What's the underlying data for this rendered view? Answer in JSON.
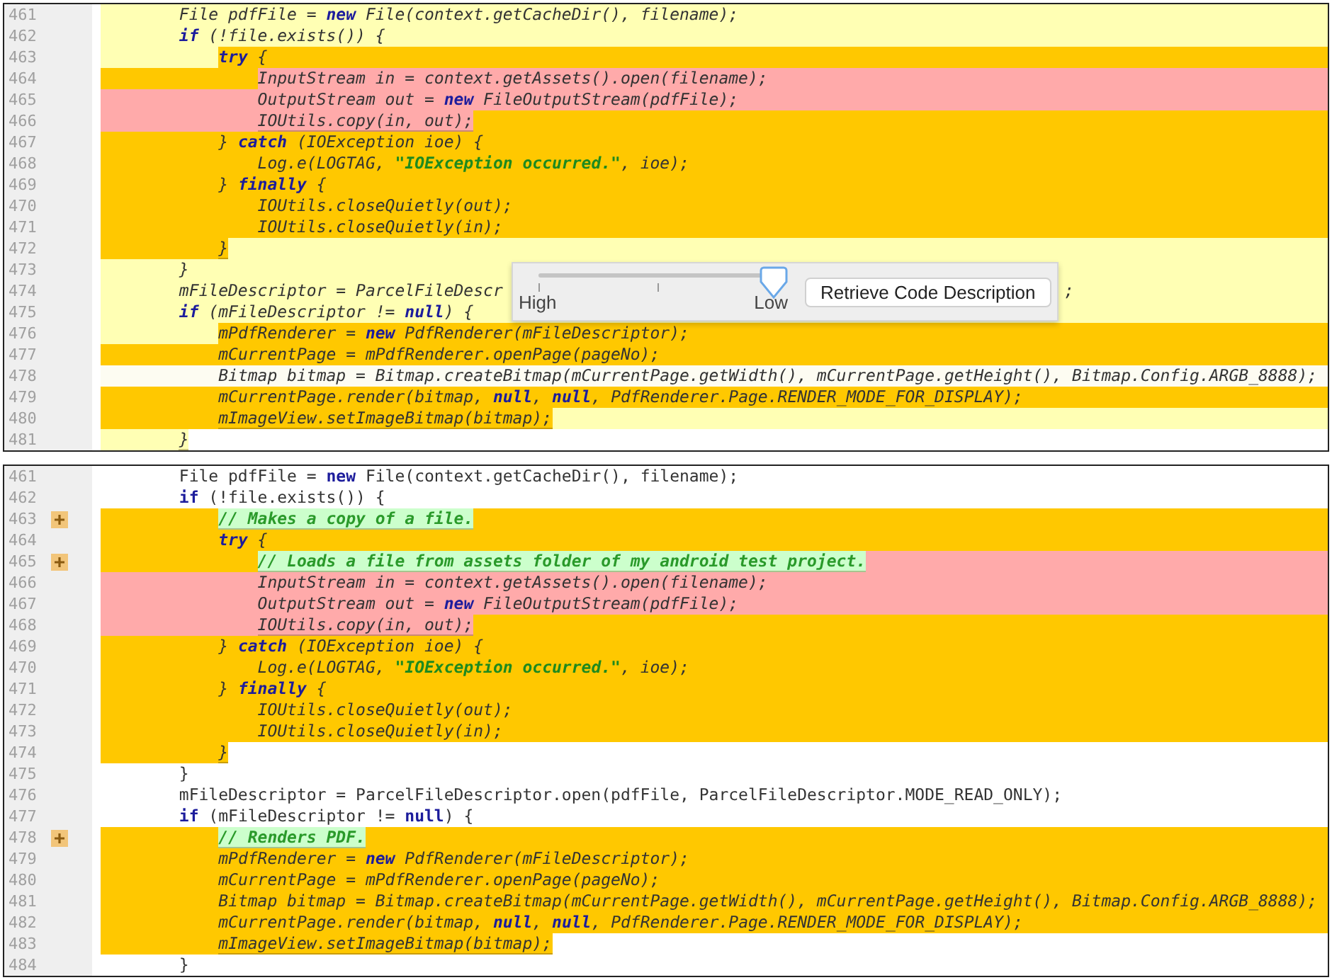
{
  "panels": [
    {
      "lines": [
        {
          "n": "461",
          "italic": true,
          "color": "#ffffb4",
          "bands": [
            {
              "kind": "rest",
              "color": "#ffffb4"
            }
          ],
          "code": [
            {
              "kind": "plain",
              "text": "        File pdfFile = "
            },
            {
              "kind": "keyword",
              "text": "new"
            },
            {
              "kind": "plain",
              "text": " File(context.getCacheDir(), filename);"
            }
          ]
        },
        {
          "n": "462",
          "italic": true,
          "color": "#ffffb4",
          "bands": [
            {
              "kind": "lead",
              "color": "#ffffb4"
            },
            {
              "kind": "rest",
              "color": "#ffffb4"
            }
          ],
          "code": [
            {
              "kind": "keyword",
              "text": "        if"
            },
            {
              "kind": "plain",
              "text": " (!file.exists()) {"
            }
          ]
        },
        {
          "n": "463",
          "italic": true,
          "color": "#ffc800",
          "bands": [
            {
              "kind": "lead",
              "color": "#ffffb4"
            },
            {
              "kind": "rest",
              "color": "#ffc800"
            }
          ],
          "code": [
            {
              "kind": "keyword",
              "text": "            try"
            },
            {
              "kind": "plain",
              "text": " {"
            }
          ]
        },
        {
          "n": "464",
          "italic": true,
          "color": "#ffaaaa",
          "bands": [
            {
              "kind": "lead",
              "color": "#ffc800"
            },
            {
              "kind": "rest",
              "color": "#ffaaaa"
            }
          ],
          "code": [
            {
              "kind": "plain",
              "text": "                InputStream in = context.getAssets().open(filename);"
            }
          ]
        },
        {
          "n": "465",
          "italic": true,
          "color": "#ffaaaa",
          "bands": [
            {
              "kind": "lead",
              "color": "#ffaaaa"
            },
            {
              "kind": "rest",
              "color": "#ffaaaa"
            }
          ],
          "code": [
            {
              "kind": "plain",
              "text": "                OutputStream out = "
            },
            {
              "kind": "keyword",
              "text": "new"
            },
            {
              "kind": "plain",
              "text": " FileOutputStream(pdfFile);"
            }
          ]
        },
        {
          "n": "466",
          "italic": true,
          "color": "#ffaaaa",
          "bands": [
            {
              "kind": "lead",
              "color": "#ffaaaa"
            },
            {
              "kind": "rest",
              "color": "#ffc800"
            }
          ],
          "code": [
            {
              "kind": "plain",
              "text": "                IOUtils.copy(in, out);"
            }
          ]
        },
        {
          "n": "467",
          "italic": true,
          "color": "#ffc800",
          "bands": [
            {
              "kind": "lead",
              "color": "#ffc800"
            },
            {
              "kind": "rest",
              "color": "#ffc800"
            }
          ],
          "code": [
            {
              "kind": "plain",
              "text": "            } "
            },
            {
              "kind": "keyword",
              "text": "catch"
            },
            {
              "kind": "plain",
              "text": " (IOException ioe) {"
            }
          ]
        },
        {
          "n": "468",
          "italic": true,
          "color": "#ffc800",
          "bands": [
            {
              "kind": "lead",
              "color": "#ffc800"
            },
            {
              "kind": "rest",
              "color": "#ffc800"
            }
          ],
          "code": [
            {
              "kind": "plain",
              "text": "                Log.e(LOGTAG, "
            },
            {
              "kind": "string",
              "text": "\"IOException occurred.\""
            },
            {
              "kind": "plain",
              "text": ", ioe);"
            }
          ]
        },
        {
          "n": "469",
          "italic": true,
          "color": "#ffc800",
          "bands": [
            {
              "kind": "lead",
              "color": "#ffc800"
            },
            {
              "kind": "rest",
              "color": "#ffc800"
            }
          ],
          "code": [
            {
              "kind": "plain",
              "text": "            } "
            },
            {
              "kind": "keyword",
              "text": "finally"
            },
            {
              "kind": "plain",
              "text": " {"
            }
          ]
        },
        {
          "n": "470",
          "italic": true,
          "color": "#ffc800",
          "bands": [
            {
              "kind": "lead",
              "color": "#ffc800"
            },
            {
              "kind": "rest",
              "color": "#ffc800"
            }
          ],
          "code": [
            {
              "kind": "plain",
              "text": "                IOUtils.closeQuietly(out);"
            }
          ]
        },
        {
          "n": "471",
          "italic": true,
          "color": "#ffc800",
          "bands": [
            {
              "kind": "lead",
              "color": "#ffc800"
            },
            {
              "kind": "rest",
              "color": "#ffc800"
            }
          ],
          "code": [
            {
              "kind": "plain",
              "text": "                IOUtils.closeQuietly(in);"
            }
          ]
        },
        {
          "n": "472",
          "italic": true,
          "color": "#ffc800",
          "bands": [
            {
              "kind": "lead",
              "color": "#ffc800"
            },
            {
              "kind": "rest",
              "color": "#ffffb4"
            }
          ],
          "code": [
            {
              "kind": "plain",
              "text": "            }"
            }
          ]
        },
        {
          "n": "473",
          "italic": true,
          "color": "#ffffb4",
          "bands": [
            {
              "kind": "lead",
              "color": "#ffffb4"
            },
            {
              "kind": "rest",
              "color": "#ffffb4"
            }
          ],
          "code": [
            {
              "kind": "plain",
              "text": "        }"
            }
          ]
        },
        {
          "n": "474",
          "italic": true,
          "color": "#ffffb4",
          "bands": [
            {
              "kind": "lead",
              "color": "#ffffb4"
            },
            {
              "kind": "rest",
              "color": "#ffffb4"
            }
          ],
          "code": [
            {
              "kind": "plain",
              "text": "        mFileDescriptor = ParcelFileDescr"
            }
          ],
          "tail": ";"
        },
        {
          "n": "475",
          "italic": true,
          "color": "#ffffb4",
          "bands": [
            {
              "kind": "lead",
              "color": "#ffffb4"
            },
            {
              "kind": "rest",
              "color": "#ffffb4"
            }
          ],
          "code": [
            {
              "kind": "keyword",
              "text": "        if"
            },
            {
              "kind": "plain",
              "text": " (mFileDescriptor != "
            },
            {
              "kind": "keyword",
              "text": "null"
            },
            {
              "kind": "plain",
              "text": ") {"
            }
          ]
        },
        {
          "n": "476",
          "italic": true,
          "color": "#ffc800",
          "bands": [
            {
              "kind": "lead",
              "color": "#ffffb4"
            },
            {
              "kind": "rest",
              "color": "#ffc800"
            }
          ],
          "code": [
            {
              "kind": "plain",
              "text": "            mPdfRenderer = "
            },
            {
              "kind": "keyword",
              "text": "new"
            },
            {
              "kind": "plain",
              "text": " PdfRenderer(mFileDescriptor);"
            }
          ]
        },
        {
          "n": "477",
          "italic": true,
          "color": "#ffc800",
          "bands": [
            {
              "kind": "lead",
              "color": "#ffc800"
            },
            {
              "kind": "rest",
              "color": "#ffc800"
            }
          ],
          "code": [
            {
              "kind": "plain",
              "text": "            mCurrentPage = mPdfRenderer.openPage(pageNo);"
            }
          ]
        },
        {
          "n": "478",
          "italic": true,
          "color": "#fdfcf2",
          "bands": [
            {
              "kind": "lead",
              "color": "#fdfcf2"
            },
            {
              "kind": "rest",
              "color": "#fdfcf2"
            }
          ],
          "code": [
            {
              "kind": "plain",
              "text": "            Bitmap bitmap = Bitmap.createBitmap(mCurrentPage.getWidth(), mCurrentPage.getHeight(), Bitmap.Config.ARGB_8888);"
            }
          ]
        },
        {
          "n": "479",
          "italic": true,
          "color": "#ffc800",
          "bands": [
            {
              "kind": "lead",
              "color": "#ffc800"
            },
            {
              "kind": "rest",
              "color": "#ffc800"
            }
          ],
          "code": [
            {
              "kind": "plain",
              "text": "            mCurrentPage.render(bitmap, "
            },
            {
              "kind": "keyword",
              "text": "null"
            },
            {
              "kind": "plain",
              "text": ", "
            },
            {
              "kind": "keyword",
              "text": "null"
            },
            {
              "kind": "plain",
              "text": ", PdfRenderer.Page.RENDER_MODE_FOR_DISPLAY);"
            }
          ]
        },
        {
          "n": "480",
          "italic": true,
          "color": "#ffc800",
          "bands": [
            {
              "kind": "lead",
              "color": "#ffc800"
            },
            {
              "kind": "rest",
              "color": "#ffffb4"
            }
          ],
          "code": [
            {
              "kind": "plain",
              "text": "            mImageView.setImageBitmap(bitmap);"
            }
          ]
        },
        {
          "n": "481",
          "italic": true,
          "color": "#ffffb4",
          "bands": [
            {
              "kind": "lead",
              "color": "#ffffb4"
            }
          ],
          "code": [
            {
              "kind": "plain",
              "text": "        }"
            }
          ]
        }
      ],
      "popup": {
        "slider": {
          "min_label": "High",
          "max_label": "Low",
          "level": 1
        },
        "button": "Retrieve Code Description"
      }
    },
    {
      "lines": [
        {
          "n": "461",
          "fold": false,
          "italic": false,
          "code": [
            {
              "kind": "plain",
              "text": "        File pdfFile = "
            },
            {
              "kind": "keyword",
              "text": "new"
            },
            {
              "kind": "plain",
              "text": " File(context.getCacheDir(), filename);"
            }
          ]
        },
        {
          "n": "462",
          "fold": false,
          "italic": false,
          "code": [
            {
              "kind": "keyword",
              "text": "        if"
            },
            {
              "kind": "plain",
              "text": " (!file.exists()) {"
            }
          ]
        },
        {
          "n": "463",
          "fold": true,
          "italic": true,
          "color": "#ccffcc",
          "bands": [
            {
              "kind": "rest",
              "color": "#ffc800"
            }
          ],
          "code": [
            {
              "kind": "comment",
              "text": "            // Makes a copy of a file."
            }
          ]
        },
        {
          "n": "464",
          "fold": false,
          "italic": true,
          "color": "#ffc800",
          "bands": [
            {
              "kind": "lead",
              "color": "#ffc800"
            },
            {
              "kind": "rest",
              "color": "#ffc800"
            }
          ],
          "code": [
            {
              "kind": "keyword",
              "text": "            try"
            },
            {
              "kind": "plain",
              "text": " {"
            }
          ]
        },
        {
          "n": "465",
          "fold": true,
          "italic": true,
          "color": "#ccffcc",
          "bands": [
            {
              "kind": "lead",
              "color": "#ffc800"
            },
            {
              "kind": "rest",
              "color": "#ffaaaa"
            }
          ],
          "code": [
            {
              "kind": "comment",
              "text": "                // Loads a file from assets folder of my android test project."
            }
          ]
        },
        {
          "n": "466",
          "fold": false,
          "italic": true,
          "color": "#ffaaaa",
          "bands": [
            {
              "kind": "lead",
              "color": "#ffaaaa"
            },
            {
              "kind": "rest",
              "color": "#ffaaaa"
            }
          ],
          "code": [
            {
              "kind": "plain",
              "text": "                InputStream in = context.getAssets().open(filename);"
            }
          ]
        },
        {
          "n": "467",
          "fold": false,
          "italic": true,
          "color": "#ffaaaa",
          "bands": [
            {
              "kind": "lead",
              "color": "#ffaaaa"
            },
            {
              "kind": "rest",
              "color": "#ffaaaa"
            }
          ],
          "code": [
            {
              "kind": "plain",
              "text": "                OutputStream out = "
            },
            {
              "kind": "keyword",
              "text": "new"
            },
            {
              "kind": "plain",
              "text": " FileOutputStream(pdfFile);"
            }
          ]
        },
        {
          "n": "468",
          "fold": false,
          "italic": true,
          "color": "#ffaaaa",
          "bands": [
            {
              "kind": "lead",
              "color": "#ffaaaa"
            },
            {
              "kind": "rest",
              "color": "#ffc800"
            }
          ],
          "code": [
            {
              "kind": "plain",
              "text": "                IOUtils.copy(in, out);"
            }
          ]
        },
        {
          "n": "469",
          "fold": false,
          "italic": true,
          "color": "#ffc800",
          "bands": [
            {
              "kind": "lead",
              "color": "#ffc800"
            },
            {
              "kind": "rest",
              "color": "#ffc800"
            }
          ],
          "code": [
            {
              "kind": "plain",
              "text": "            } "
            },
            {
              "kind": "keyword",
              "text": "catch"
            },
            {
              "kind": "plain",
              "text": " (IOException ioe) {"
            }
          ]
        },
        {
          "n": "470",
          "fold": false,
          "italic": true,
          "color": "#ffc800",
          "bands": [
            {
              "kind": "lead",
              "color": "#ffc800"
            },
            {
              "kind": "rest",
              "color": "#ffc800"
            }
          ],
          "code": [
            {
              "kind": "plain",
              "text": "                Log.e(LOGTAG, "
            },
            {
              "kind": "string",
              "text": "\"IOException occurred.\""
            },
            {
              "kind": "plain",
              "text": ", ioe);"
            }
          ]
        },
        {
          "n": "471",
          "fold": false,
          "italic": true,
          "color": "#ffc800",
          "bands": [
            {
              "kind": "lead",
              "color": "#ffc800"
            },
            {
              "kind": "rest",
              "color": "#ffc800"
            }
          ],
          "code": [
            {
              "kind": "plain",
              "text": "            } "
            },
            {
              "kind": "keyword",
              "text": "finally"
            },
            {
              "kind": "plain",
              "text": " {"
            }
          ]
        },
        {
          "n": "472",
          "fold": false,
          "italic": true,
          "color": "#ffc800",
          "bands": [
            {
              "kind": "lead",
              "color": "#ffc800"
            },
            {
              "kind": "rest",
              "color": "#ffc800"
            }
          ],
          "code": [
            {
              "kind": "plain",
              "text": "                IOUtils.closeQuietly(out);"
            }
          ]
        },
        {
          "n": "473",
          "fold": false,
          "italic": true,
          "color": "#ffc800",
          "bands": [
            {
              "kind": "lead",
              "color": "#ffc800"
            },
            {
              "kind": "rest",
              "color": "#ffc800"
            }
          ],
          "code": [
            {
              "kind": "plain",
              "text": "                IOUtils.closeQuietly(in);"
            }
          ]
        },
        {
          "n": "474",
          "fold": false,
          "italic": true,
          "color": "#ffc800",
          "bands": [
            {
              "kind": "lead",
              "color": "#ffc800"
            }
          ],
          "code": [
            {
              "kind": "plain",
              "text": "            }"
            }
          ]
        },
        {
          "n": "475",
          "fold": false,
          "italic": false,
          "code": [
            {
              "kind": "plain",
              "text": "        }"
            }
          ]
        },
        {
          "n": "476",
          "fold": false,
          "italic": false,
          "code": [
            {
              "kind": "plain",
              "text": "        mFileDescriptor = ParcelFileDescriptor.open(pdfFile, ParcelFileDescriptor.MODE_READ_ONLY);"
            }
          ]
        },
        {
          "n": "477",
          "fold": false,
          "italic": false,
          "code": [
            {
              "kind": "keyword",
              "text": "        if"
            },
            {
              "kind": "plain",
              "text": " (mFileDescriptor != "
            },
            {
              "kind": "keyword",
              "text": "null"
            },
            {
              "kind": "plain",
              "text": ") {"
            }
          ]
        },
        {
          "n": "478",
          "fold": true,
          "italic": true,
          "color": "#ccffcc",
          "bands": [
            {
              "kind": "rest",
              "color": "#ffc800"
            }
          ],
          "code": [
            {
              "kind": "comment",
              "text": "            // Renders PDF."
            }
          ]
        },
        {
          "n": "479",
          "fold": false,
          "italic": true,
          "color": "#ffc800",
          "bands": [
            {
              "kind": "lead",
              "color": "#ffc800"
            },
            {
              "kind": "rest",
              "color": "#ffc800"
            }
          ],
          "code": [
            {
              "kind": "plain",
              "text": "            mPdfRenderer = "
            },
            {
              "kind": "keyword",
              "text": "new"
            },
            {
              "kind": "plain",
              "text": " PdfRenderer(mFileDescriptor);"
            }
          ]
        },
        {
          "n": "480",
          "fold": false,
          "italic": true,
          "color": "#ffc800",
          "bands": [
            {
              "kind": "lead",
              "color": "#ffc800"
            },
            {
              "kind": "rest",
              "color": "#ffc800"
            }
          ],
          "code": [
            {
              "kind": "plain",
              "text": "            mCurrentPage = mPdfRenderer.openPage(pageNo);"
            }
          ]
        },
        {
          "n": "481",
          "fold": false,
          "italic": true,
          "color": "#ffc800",
          "bands": [
            {
              "kind": "lead",
              "color": "#ffc800"
            },
            {
              "kind": "rest",
              "color": "#ffc800"
            }
          ],
          "code": [
            {
              "kind": "plain",
              "text": "            Bitmap bitmap = Bitmap.createBitmap(mCurrentPage.getWidth(), mCurrentPage.getHeight(), Bitmap.Config.ARGB_8888);"
            }
          ]
        },
        {
          "n": "482",
          "fold": false,
          "italic": true,
          "color": "#ffc800",
          "bands": [
            {
              "kind": "lead",
              "color": "#ffc800"
            },
            {
              "kind": "rest",
              "color": "#ffc800"
            }
          ],
          "code": [
            {
              "kind": "plain",
              "text": "            mCurrentPage.render(bitmap, "
            },
            {
              "kind": "keyword",
              "text": "null"
            },
            {
              "kind": "plain",
              "text": ", "
            },
            {
              "kind": "keyword",
              "text": "null"
            },
            {
              "kind": "plain",
              "text": ", PdfRenderer.Page.RENDER_MODE_FOR_DISPLAY);"
            }
          ]
        },
        {
          "n": "483",
          "fold": false,
          "italic": true,
          "color": "#ffc800",
          "bands": [
            {
              "kind": "lead",
              "color": "#ffc800"
            }
          ],
          "code": [
            {
              "kind": "plain",
              "text": "            mImageView.setImageBitmap(bitmap);"
            }
          ]
        },
        {
          "n": "484",
          "fold": false,
          "italic": false,
          "code": [
            {
              "kind": "plain",
              "text": "        }"
            }
          ]
        }
      ]
    }
  ]
}
